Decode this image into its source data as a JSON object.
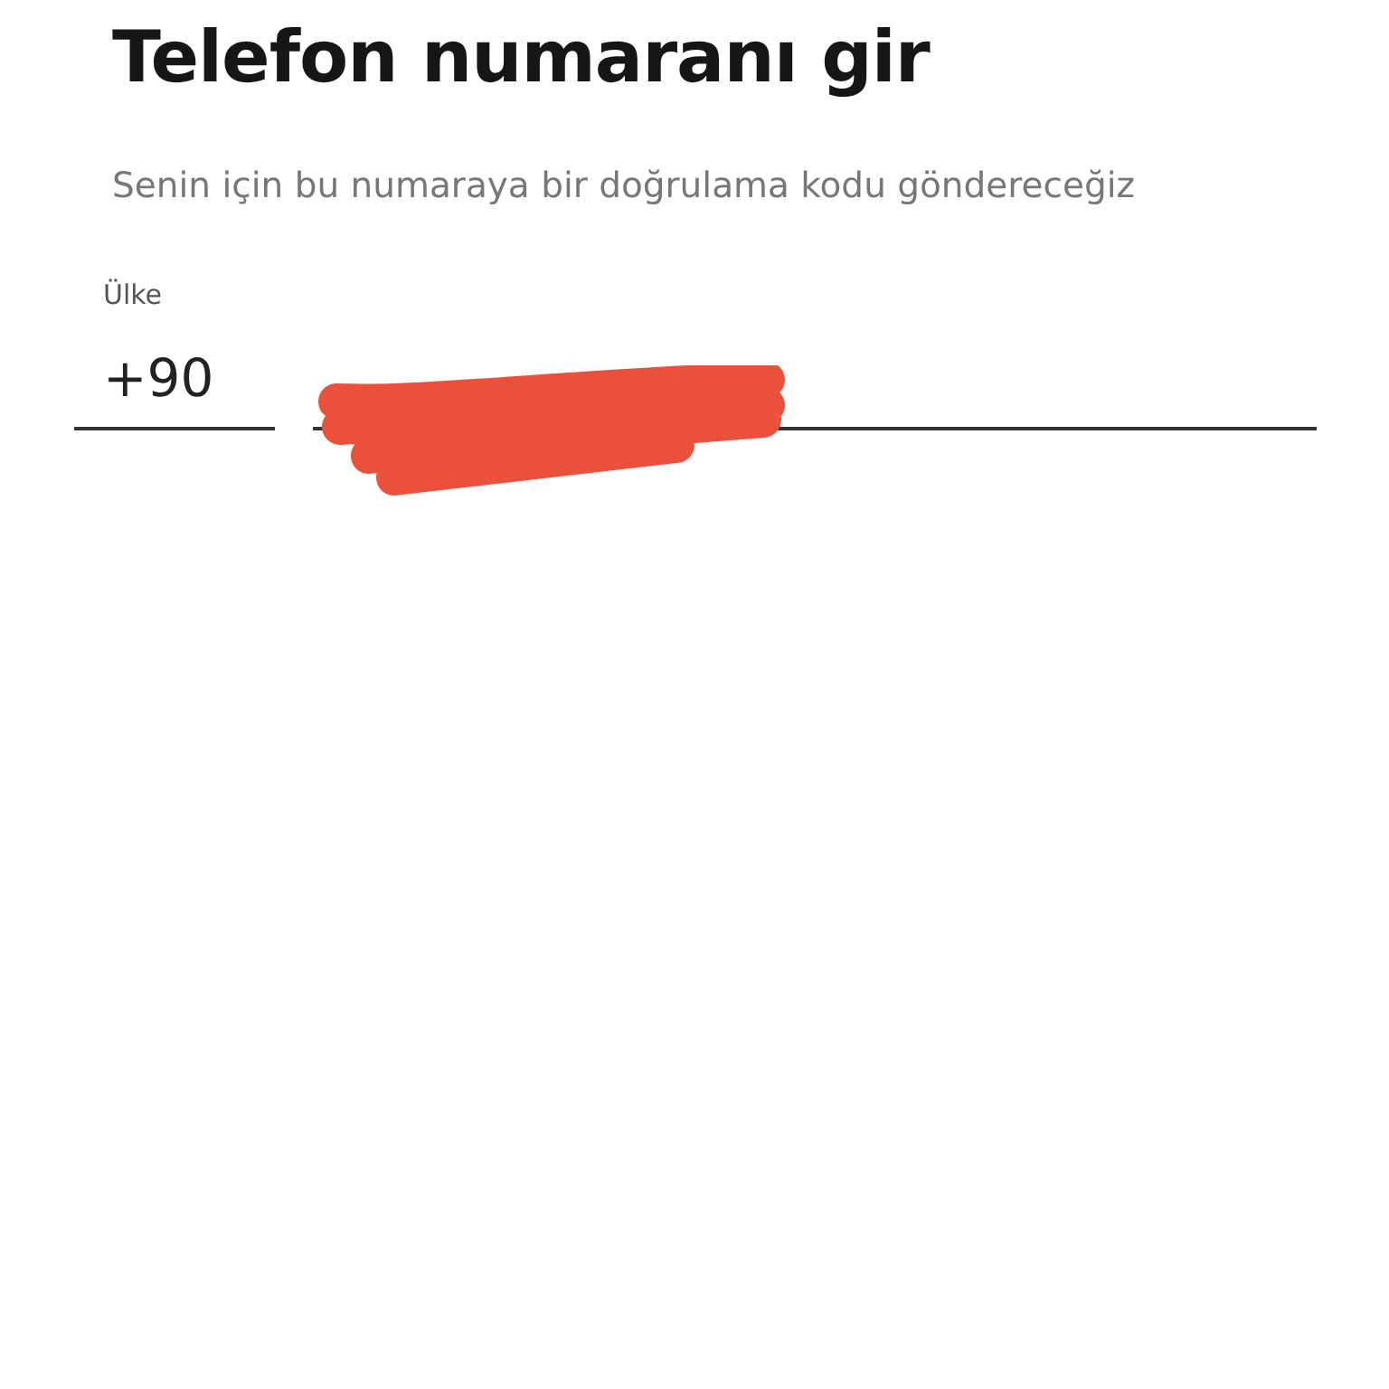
{
  "title": "Telefon numaranı gir",
  "subtitle": "Senin için bu numaraya bir doğrulama kodu göndereceğiz",
  "country": {
    "label": "Ülke",
    "code": "+90"
  },
  "phone": {
    "redacted": true
  }
}
